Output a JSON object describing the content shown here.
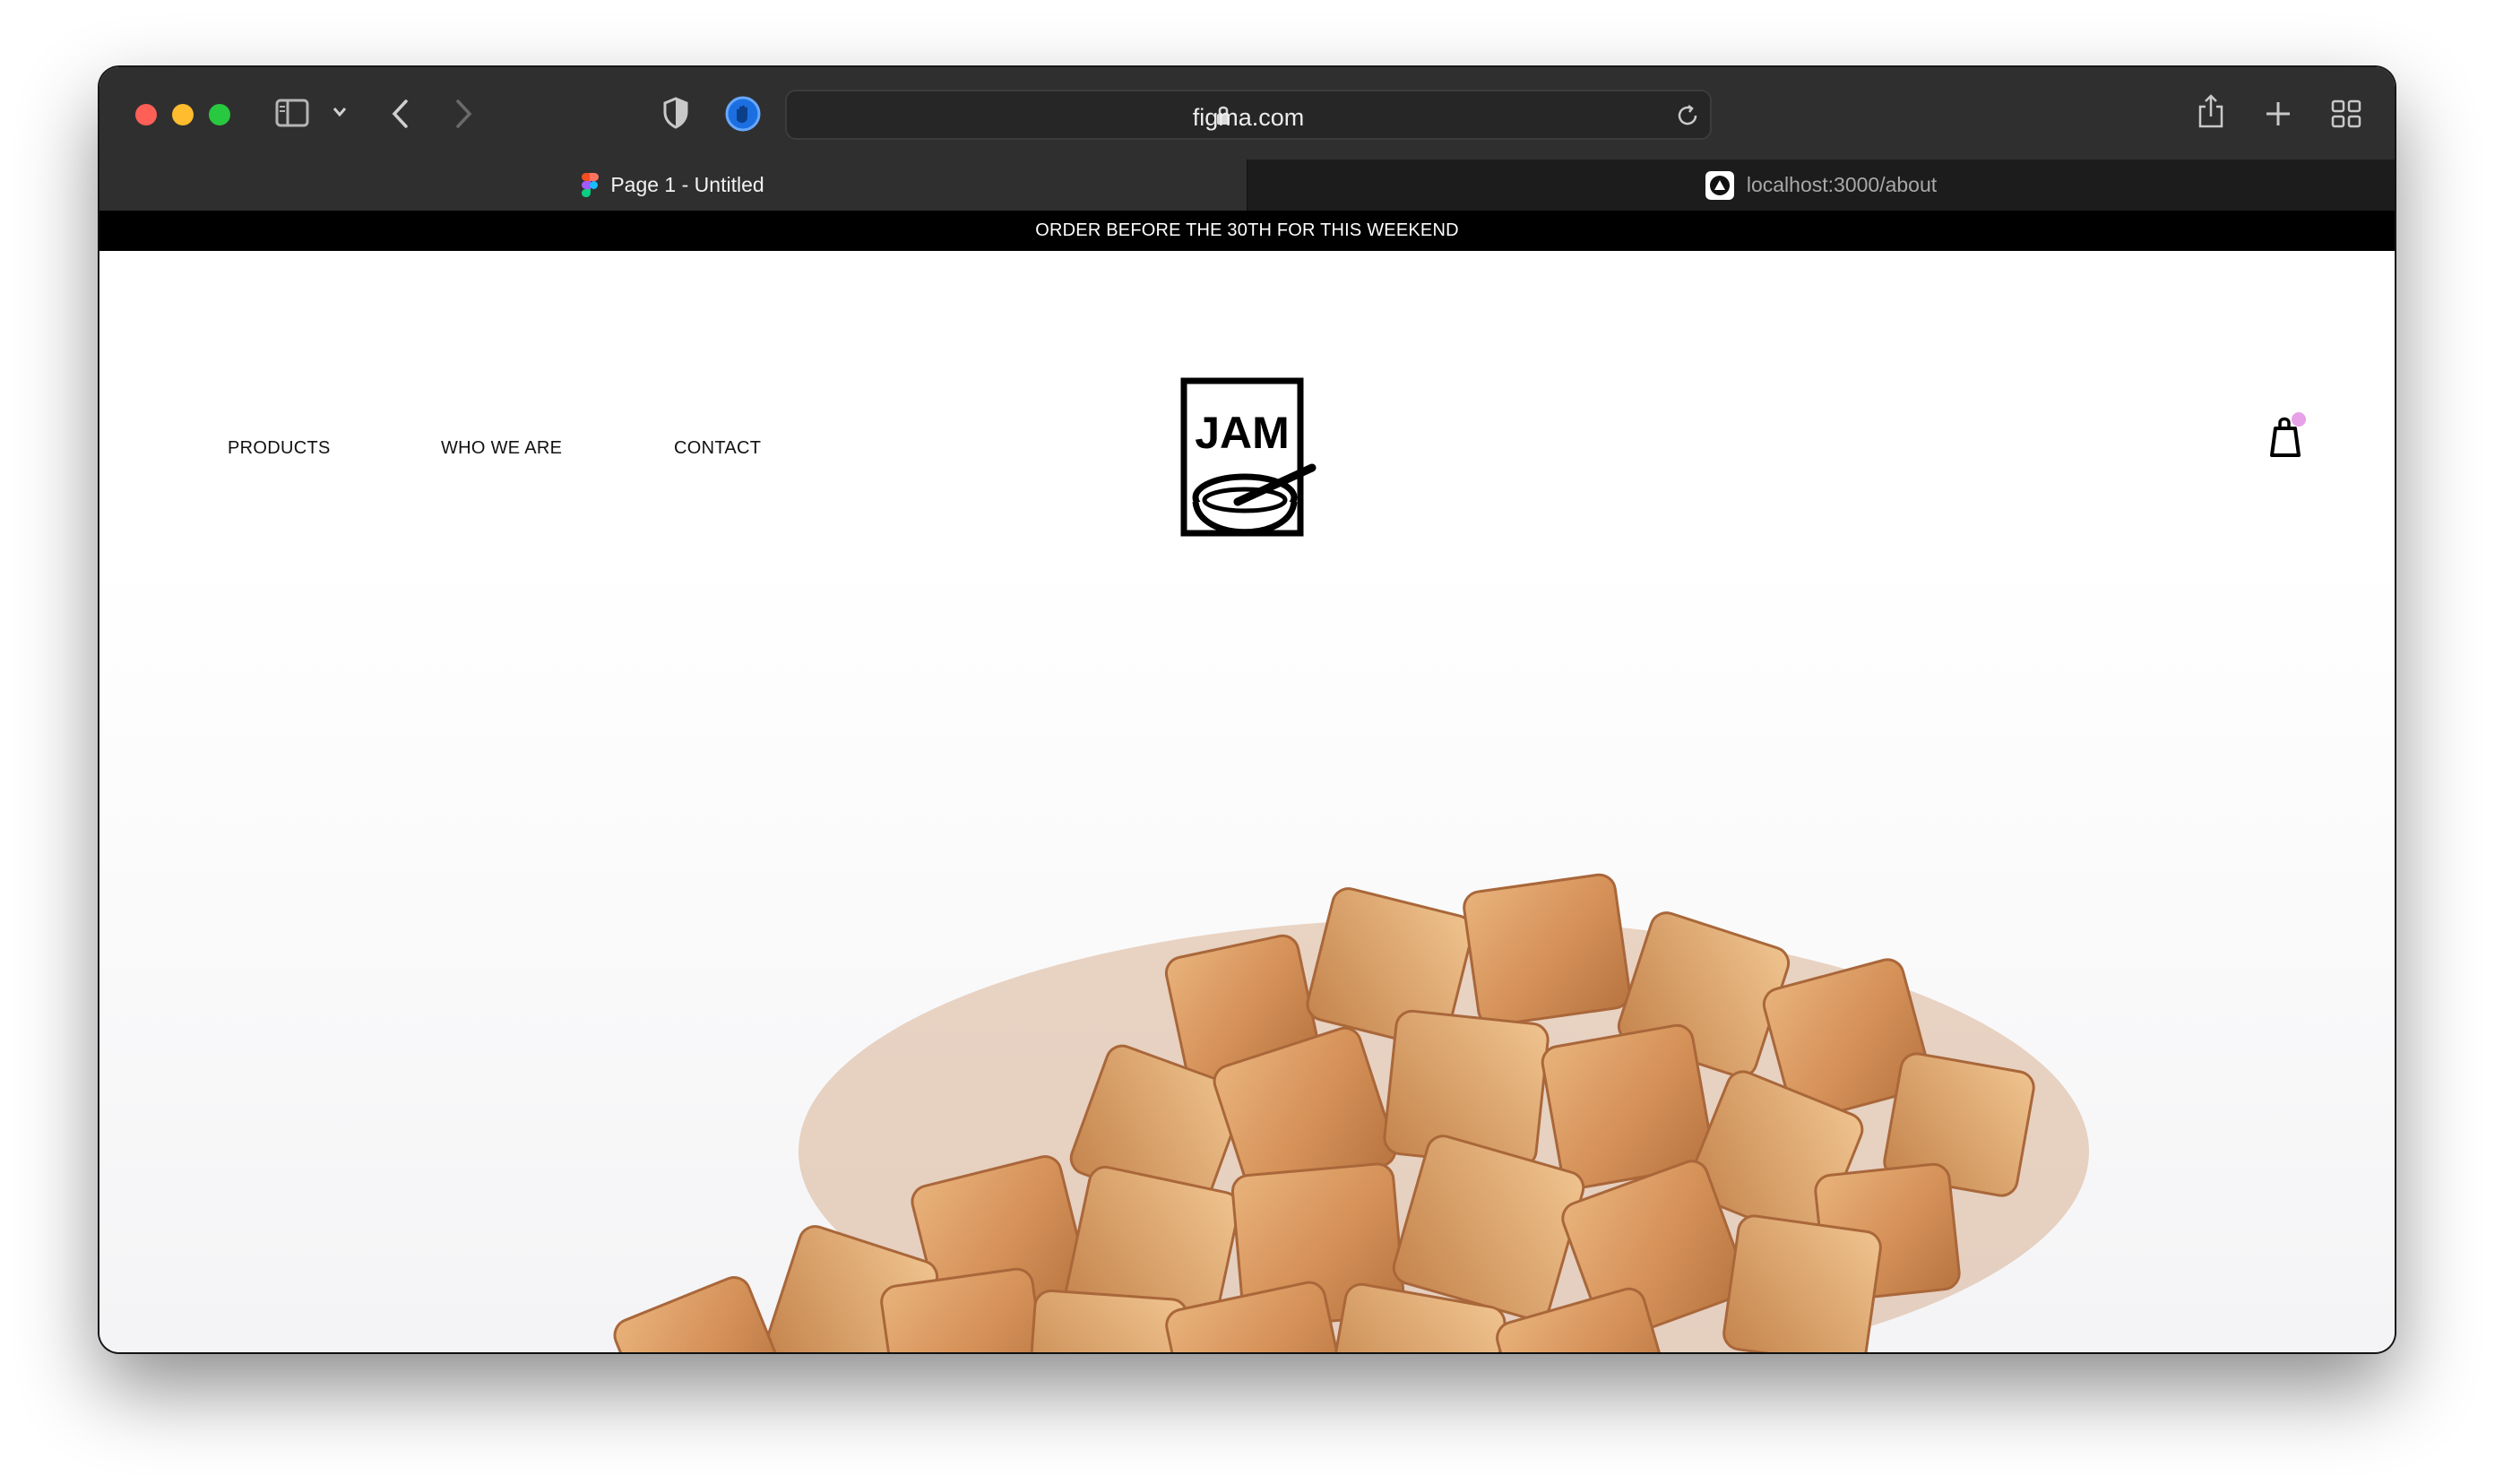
{
  "browser": {
    "url": "figma.com",
    "tabs": [
      {
        "label": "Page 1 - Untitled",
        "active": true
      },
      {
        "label": "localhost:3000/about",
        "active": false
      }
    ],
    "icons": [
      "sidebar-icon",
      "chevron-down-icon",
      "back-icon",
      "forward-icon",
      "shield-icon",
      "extension-icon",
      "lock-icon",
      "reload-icon",
      "share-icon",
      "new-tab-icon",
      "tab-overview-icon"
    ]
  },
  "site": {
    "announcement": "ORDER BEFORE THE 30TH FOR THIS WEEKEND",
    "nav": {
      "products": "PRODUCTS",
      "who_we_are": "WHO WE ARE",
      "contact": "CONTACT"
    },
    "logo_text": "JAM",
    "cart_badge_color": "#e6a1e8",
    "hero_image": "cinnamon-cereal-pile"
  },
  "colors": {
    "chrome_dark": "#2f2f2f",
    "announcement_bg": "#000000",
    "traffic_red": "#fe5f57",
    "traffic_yellow": "#febc2e",
    "traffic_green": "#28c840"
  }
}
